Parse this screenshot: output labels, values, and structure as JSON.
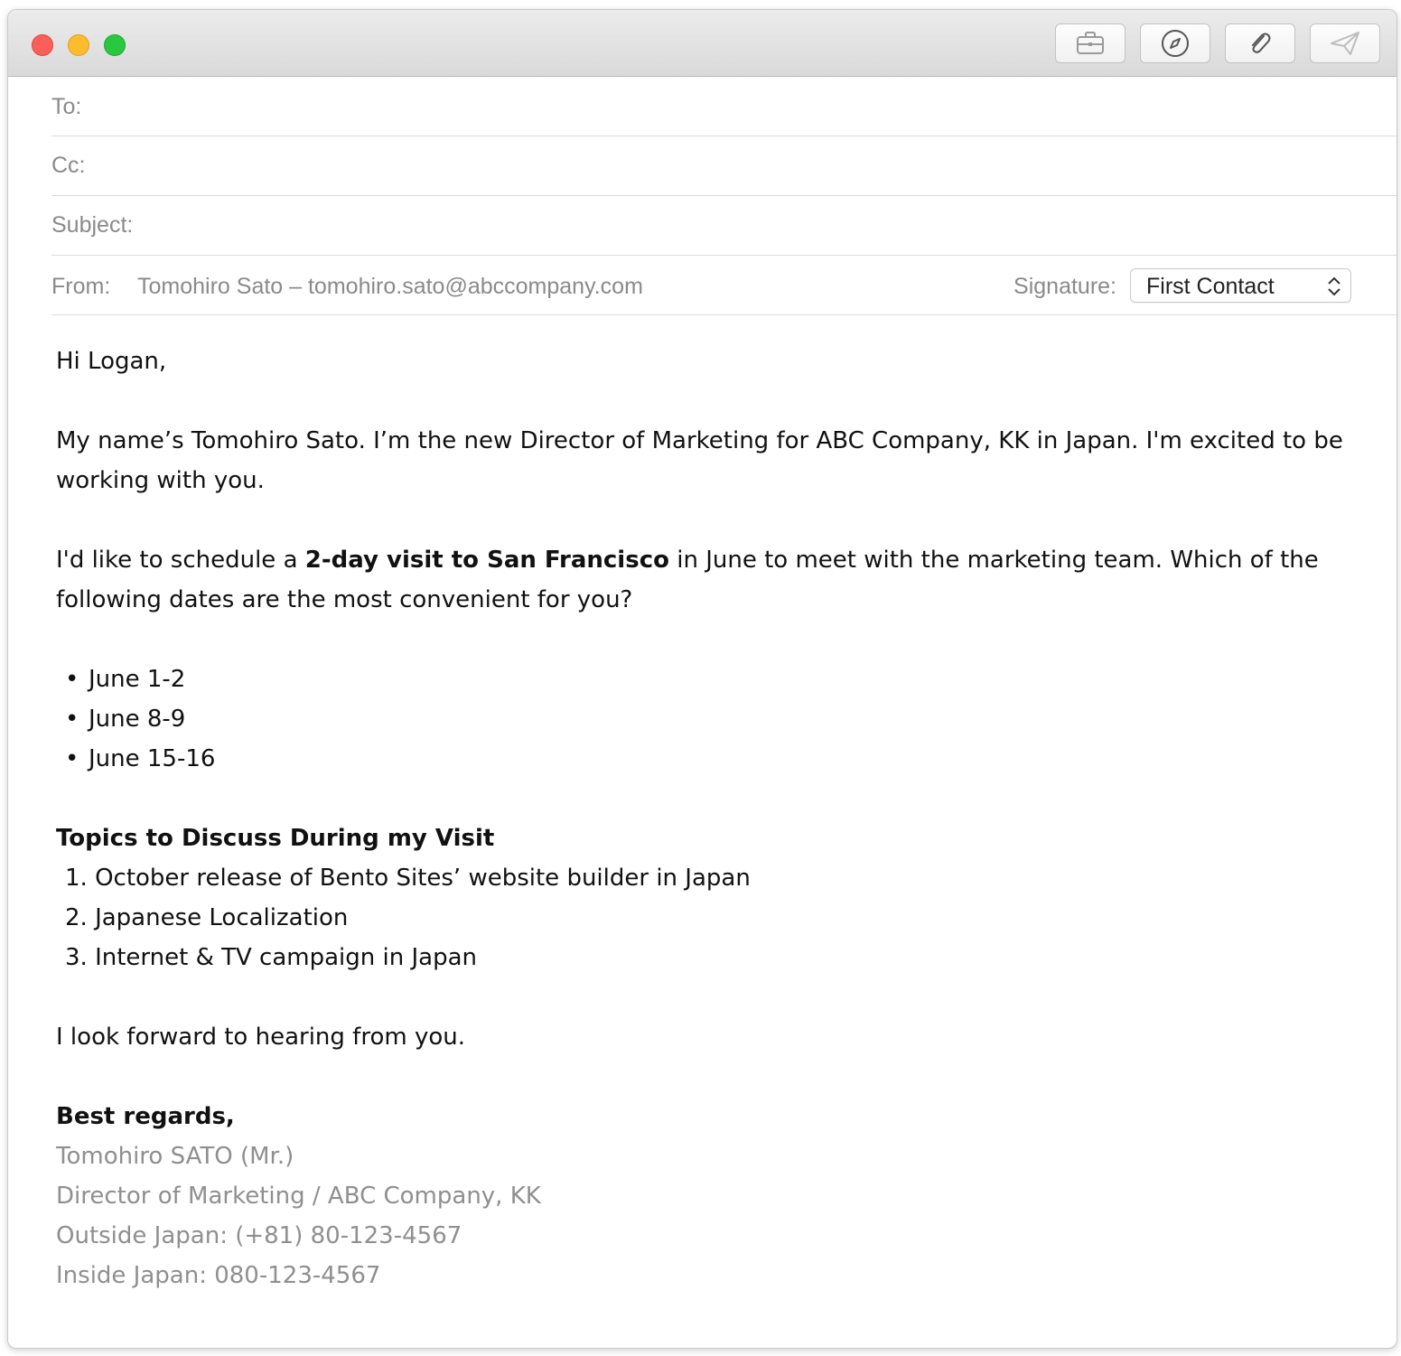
{
  "window": {
    "controls": [
      "close",
      "minimize",
      "maximize"
    ]
  },
  "toolbar": {
    "buttons": [
      {
        "icon": "briefcase-icon"
      },
      {
        "icon": "compass-icon"
      },
      {
        "icon": "paperclip-icon"
      },
      {
        "icon": "send-icon"
      }
    ]
  },
  "header": {
    "to_label": "To:",
    "to_value": "",
    "cc_label": "Cc:",
    "cc_value": "",
    "subject_label": "Subject:",
    "subject_value": "",
    "from_label": "From:",
    "from_value": "Tomohiro Sato – tomohiro.sato@abccompany.com",
    "signature_label": "Signature:",
    "signature_value": "First Contact"
  },
  "message": {
    "greeting": "Hi Logan,",
    "intro": "My name’s Tomohiro Sato. I’m the new Director of Marketing for ABC Company, KK in Japan. I'm excited to be working with you.",
    "schedule_before": "I'd like to schedule a ",
    "schedule_bold": "2-day visit to San Francisco",
    "schedule_after": " in June to meet with the marketing team. Which of the following dates are the most convenient for you?",
    "dates": [
      "June 1-2",
      "June 8-9",
      "June 15-16"
    ],
    "topics_heading": "Topics to Discuss During my Visit",
    "topics": [
      "1. October release of Bento Sites’ website builder in Japan",
      "2. Japanese Localization",
      "3. Internet & TV campaign in Japan"
    ],
    "closing": "I look forward to hearing from you.",
    "signoff": "Best regards,",
    "signature_lines": [
      "Tomohiro SATO (Mr.)",
      "Director of Marketing / ABC Company, KK",
      "Outside Japan: (+81) 80-123-4567",
      "Inside Japan: 080-123-4567"
    ]
  }
}
